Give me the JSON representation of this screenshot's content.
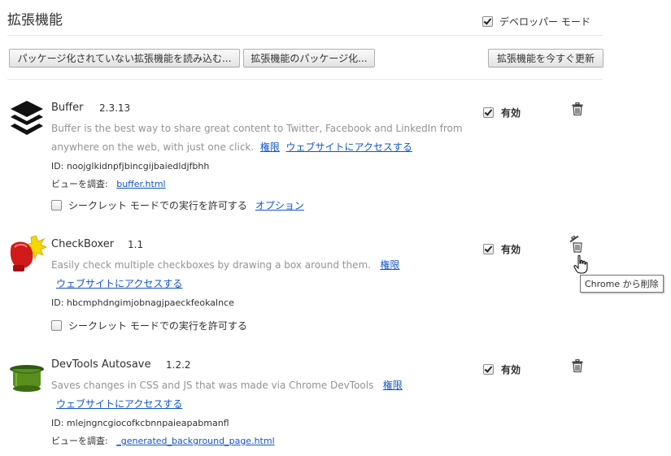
{
  "header": {
    "title": "拡張機能",
    "developer_mode_label": "デベロッパー モード",
    "developer_mode_checked": true
  },
  "toolbar": {
    "load_unpacked": "パッケージ化されていない拡張機能を読み込む...",
    "pack_extension": "拡張機能のパッケージ化...",
    "update_now": "拡張機能を今すぐ更新"
  },
  "common": {
    "enabled_label": "有効",
    "permissions_link": "権限",
    "website_link": "ウェブサイトにアクセスする",
    "incognito_label": "シークレット モードでの実行を許可する",
    "options_link": "オプション",
    "inspect_views_label": "ビューを調査:"
  },
  "extensions": [
    {
      "name": "Buffer",
      "version": "2.3.13",
      "description_line1": "Buffer is the best way to share great content to Twitter, Facebook and LinkedIn from",
      "description_line2": "anywhere on the web, with just one click.",
      "id": "ID: noojglkidnpfjbincgijbaiedldjfbhh",
      "inspect_view": "buffer.html",
      "enabled": true,
      "icon": "buffer-icon"
    },
    {
      "name": "CheckBoxer",
      "version": "1.1",
      "description_line1": "Easily check multiple checkboxes by drawing a box around them.",
      "id": "ID: hbcmphdngimjobnagjpaeckfeokalnce",
      "enabled": true,
      "icon": "boxing-glove-icon"
    },
    {
      "name": "DevTools Autosave",
      "version": "1.2.2",
      "description_line1": "Saves changes in CSS and JS that was made via Chrome DevTools",
      "id": "ID: mlejngncgiocofkcbnnpaieapabmanfl",
      "inspect_view": "_generated_background_page.html",
      "enabled": true,
      "icon": "green-hat-icon"
    }
  ],
  "tooltip": {
    "remove_from_chrome": "Chrome から削除"
  }
}
